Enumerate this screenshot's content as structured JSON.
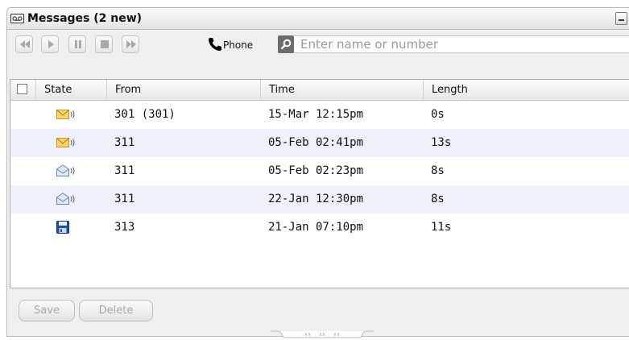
{
  "window": {
    "title": "Messages (2 new)"
  },
  "toolbar": {
    "buttons": [
      "rewind",
      "play",
      "pause",
      "stop",
      "fast-forward"
    ],
    "phone_label": "Phone",
    "search_placeholder": "Enter name or number"
  },
  "table": {
    "columns": [
      "State",
      "From",
      "Time",
      "Length"
    ],
    "rows": [
      {
        "state": "new-unheard",
        "from": "301 (301)",
        "time": "15-Mar 12:15pm",
        "length": "0s"
      },
      {
        "state": "new-unheard",
        "from": "311",
        "time": "05-Feb 02:41pm",
        "length": "13s"
      },
      {
        "state": "heard",
        "from": "311",
        "time": "05-Feb 02:23pm",
        "length": "8s"
      },
      {
        "state": "heard",
        "from": "311",
        "time": "22-Jan 12:30pm",
        "length": "8s"
      },
      {
        "state": "saved",
        "from": "313",
        "time": "21-Jan 07:10pm",
        "length": "11s"
      }
    ]
  },
  "footer": {
    "save_label": "Save",
    "delete_label": "Delete"
  },
  "colors": {
    "row_alt": "#eef1f9",
    "envelope": "#f2c23a",
    "disk": "#1d4fa8"
  }
}
